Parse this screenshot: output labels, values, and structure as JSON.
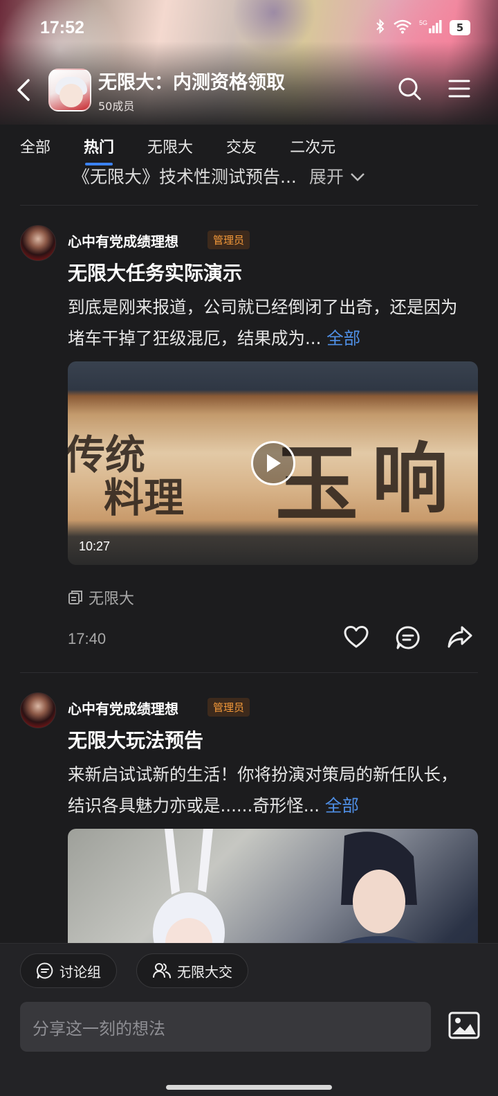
{
  "status_bar": {
    "time": "17:52",
    "network": "5G",
    "battery": "5"
  },
  "header": {
    "title": "无限大：内测资格领取",
    "members": "50成员"
  },
  "tabs": [
    {
      "label": "全部",
      "active": false
    },
    {
      "label": "热门",
      "active": true
    },
    {
      "label": "无限大",
      "active": false
    },
    {
      "label": "交友",
      "active": false
    },
    {
      "label": "二次元",
      "active": false
    }
  ],
  "previous_post": {
    "text": "《无限大》技术性测试预告...",
    "expand": "展开"
  },
  "posts": [
    {
      "author": "心中有党成绩理想",
      "badge": "管理员",
      "title": "无限大任务实际演示",
      "body": "到底是刚来报道，公司就已经倒闭了出奇，还是因为堵车干掉了狂级混厄，结果成为...",
      "more": "全部",
      "video_duration": "10:27",
      "topic": "无限大",
      "time": "17:40"
    },
    {
      "author": "心中有党成绩理想",
      "badge": "管理员",
      "title": "无限大玩法预告",
      "body": "来新启试试新的生活！你将扮演对策局的新任队长，结识各具魅力亦或是......奇形怪...",
      "more": "全部"
    }
  ],
  "bottom_bar": {
    "chips": [
      {
        "label": "讨论组",
        "icon": "chat-icon"
      },
      {
        "label": "无限大交",
        "icon": "people-icon"
      }
    ],
    "compose_placeholder": "分享这一刻的想法",
    "image_icon": "image-icon"
  },
  "colors": {
    "accent": "#3b82f6",
    "link": "#4f8fe6",
    "admin_badge": "#f59a3a",
    "background": "#1c1c1e"
  }
}
